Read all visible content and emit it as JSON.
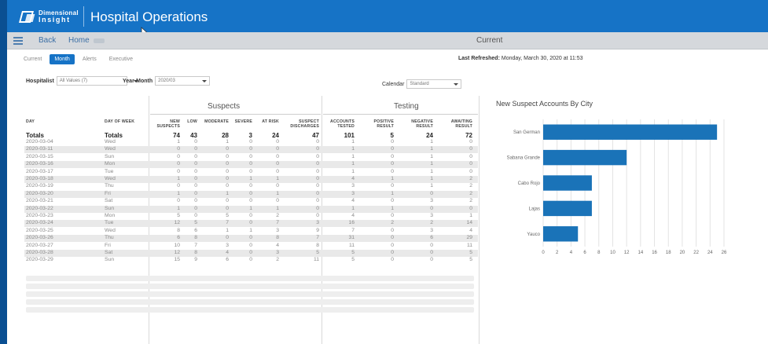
{
  "app": {
    "logo_line1": "Dimensional",
    "logo_line2": "Insight",
    "title": "Hospital Operations"
  },
  "nav": {
    "back": "Back",
    "home": "Home",
    "current": "Current"
  },
  "tabs": [
    {
      "label": "Current",
      "active": false
    },
    {
      "label": "Month",
      "active": true
    },
    {
      "label": "Alerts",
      "active": false
    },
    {
      "label": "Executive",
      "active": false
    }
  ],
  "refreshed": {
    "label": "Last Refreshed:",
    "value": "Monday, March 30, 2020 at 11:53"
  },
  "filters": {
    "hospitalist_label": "Hospitalist",
    "hospitalist_value": "All Values (7)",
    "year_month_label": "Year-Month",
    "year_month_value": "2020/03",
    "calendar_label": "Calendar",
    "calendar_value": "Standard"
  },
  "table": {
    "group_suspects": "Suspects",
    "group_testing": "Testing",
    "headers": {
      "day": "Day",
      "dow": "Day of Week",
      "new_suspects": "New Suspects",
      "low": "Low",
      "moderate": "Moderate",
      "severe": "Severe",
      "at_risk": "At Risk",
      "suspect_discharges": "Suspect Discharges",
      "accounts_tested": "Accounts Tested",
      "positive": "Positive Result",
      "negative": "Negative Result",
      "awaiting": "Awaiting Result"
    },
    "totals": [
      "Totals",
      "Totals",
      "74",
      "43",
      "28",
      "3",
      "24",
      "47",
      "101",
      "5",
      "24",
      "72"
    ],
    "rows": [
      [
        "2020-03-04",
        "Wed",
        "1",
        "0",
        "1",
        "0",
        "0",
        "0",
        "1",
        "0",
        "1",
        "0"
      ],
      [
        "2020-03-11",
        "Wed",
        "0",
        "0",
        "0",
        "0",
        "0",
        "0",
        "1",
        "0",
        "1",
        "0"
      ],
      [
        "2020-03-15",
        "Sun",
        "0",
        "0",
        "0",
        "0",
        "0",
        "0",
        "1",
        "0",
        "1",
        "0"
      ],
      [
        "2020-03-16",
        "Mon",
        "0",
        "0",
        "0",
        "0",
        "0",
        "0",
        "1",
        "0",
        "1",
        "0"
      ],
      [
        "2020-03-17",
        "Tue",
        "0",
        "0",
        "0",
        "0",
        "0",
        "0",
        "1",
        "0",
        "1",
        "0"
      ],
      [
        "2020-03-18",
        "Wed",
        "1",
        "0",
        "0",
        "1",
        "1",
        "0",
        "4",
        "1",
        "1",
        "2"
      ],
      [
        "2020-03-19",
        "Thu",
        "0",
        "0",
        "0",
        "0",
        "0",
        "0",
        "3",
        "0",
        "1",
        "2"
      ],
      [
        "2020-03-20",
        "Fri",
        "1",
        "0",
        "1",
        "0",
        "1",
        "0",
        "3",
        "1",
        "0",
        "2"
      ],
      [
        "2020-03-21",
        "Sat",
        "0",
        "0",
        "0",
        "0",
        "0",
        "0",
        "4",
        "0",
        "3",
        "2"
      ],
      [
        "2020-03-22",
        "Sun",
        "1",
        "0",
        "0",
        "1",
        "1",
        "0",
        "1",
        "1",
        "0",
        "0"
      ],
      [
        "2020-03-23",
        "Mon",
        "5",
        "0",
        "5",
        "0",
        "2",
        "0",
        "4",
        "0",
        "3",
        "1"
      ],
      [
        "2020-03-24",
        "Tue",
        "12",
        "5",
        "7",
        "0",
        "7",
        "3",
        "16",
        "2",
        "2",
        "14"
      ],
      [
        "2020-03-25",
        "Wed",
        "8",
        "6",
        "1",
        "1",
        "3",
        "9",
        "7",
        "0",
        "3",
        "4"
      ],
      [
        "2020-03-26",
        "Thu",
        "6",
        "8",
        "0",
        "0",
        "8",
        "7",
        "31",
        "0",
        "6",
        "29"
      ],
      [
        "2020-03-27",
        "Fri",
        "10",
        "7",
        "3",
        "0",
        "4",
        "8",
        "11",
        "0",
        "0",
        "11"
      ],
      [
        "2020-03-28",
        "Sat",
        "12",
        "8",
        "4",
        "0",
        "3",
        "5",
        "5",
        "0",
        "0",
        "5"
      ],
      [
        "2020-03-29",
        "Sun",
        "15",
        "9",
        "6",
        "0",
        "2",
        "11",
        "5",
        "0",
        "0",
        "5"
      ]
    ]
  },
  "chart_data": {
    "type": "bar",
    "orientation": "horizontal",
    "title": "New Suspect Accounts By City",
    "categories": [
      "San German",
      "Sabana Grande",
      "Cabo Rojo",
      "Lajas",
      "Yauco"
    ],
    "values": [
      25,
      12,
      7,
      7,
      5
    ],
    "xlim": [
      0,
      26
    ],
    "xticks": [
      0,
      2,
      4,
      6,
      8,
      10,
      12,
      14,
      16,
      18,
      20,
      22,
      24,
      26
    ],
    "grid": true,
    "bar_color": "#1a73b8"
  }
}
